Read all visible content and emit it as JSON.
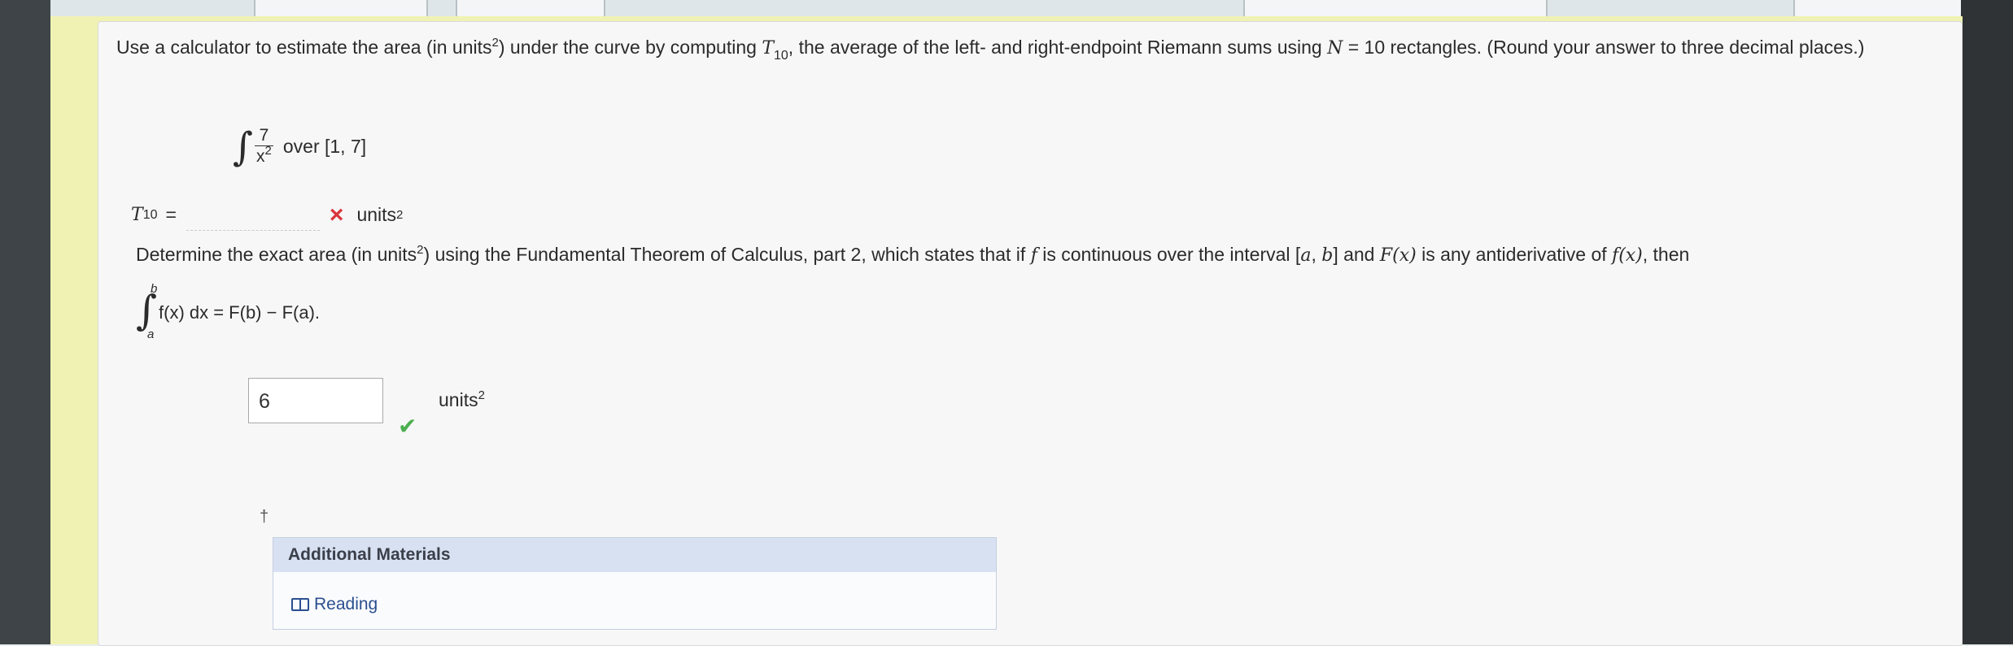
{
  "problem": {
    "intro_part1": "Use a calculator to estimate the area (in units",
    "intro_part2": ") under the curve by computing ",
    "t_symbol": "T",
    "t_sub": "10",
    "intro_part3": ", the average of the left- and right-endpoint Riemann sums using ",
    "n_symbol": "N",
    "intro_part4": " = 10 rectangles. (Round your answer to three decimal places.)",
    "sq": "2",
    "integrand_num": "7",
    "integrand_den_base": "x",
    "integral_interval": "over [1, 7]"
  },
  "t10_answer": {
    "label": "T",
    "sub": "10",
    "equals": "=",
    "value": "",
    "units": "units",
    "status_icon": "×"
  },
  "part2": {
    "text1": "Determine the exact area (in units",
    "text2": ") using the Fundamental Theorem of Calculus, part 2, which states that if ",
    "f": "f",
    "text3": " is continuous over the interval [",
    "a": "a",
    "comma": ", ",
    "b": "b",
    "text4": "] and ",
    "Fx": "F(x)",
    "text5": " is any antiderivative of ",
    "fx": "f(x)",
    "text6": ", then",
    "ftc_upper": "b",
    "ftc_lower": "a",
    "ftc_body": "f(x) dx = F(b) − F(a)."
  },
  "exact_answer": {
    "value": "6",
    "units": "units",
    "status_icon": "✔"
  },
  "dagger": "†",
  "materials": {
    "header": "Additional Materials",
    "reading_label": "Reading"
  }
}
